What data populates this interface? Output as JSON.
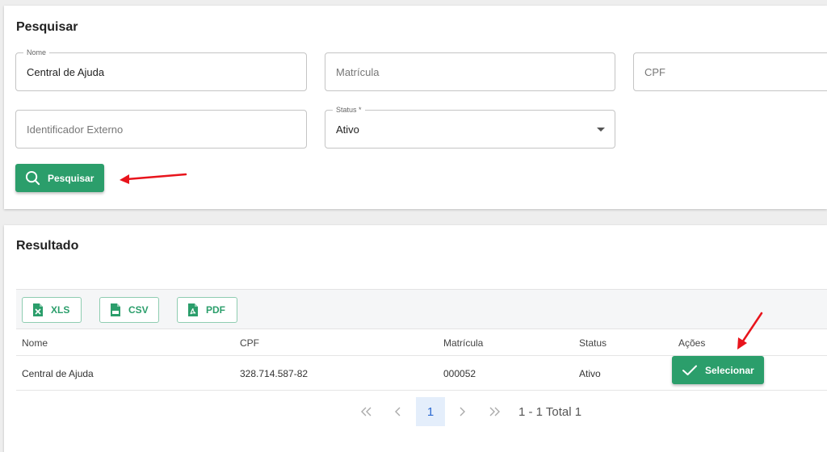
{
  "search": {
    "title": "Pesquisar",
    "fields": {
      "nome": {
        "label": "Nome",
        "value": "Central de Ajuda"
      },
      "matricula": {
        "placeholder": "Matrícula"
      },
      "cpf": {
        "placeholder": "CPF"
      },
      "identificador": {
        "placeholder": "Identificador Externo"
      },
      "status": {
        "label": "Status *",
        "value": "Ativo"
      }
    },
    "button_label": "Pesquisar"
  },
  "result": {
    "title": "Resultado",
    "export": {
      "xls": "XLS",
      "csv": "CSV",
      "pdf": "PDF"
    },
    "columns": [
      "Nome",
      "CPF",
      "Matrícula",
      "Status",
      "Ações"
    ],
    "rows": [
      {
        "nome": "Central de Ajuda",
        "cpf": "328.714.587-82",
        "matricula": "000052",
        "status": "Ativo",
        "action_label": "Selecionar"
      }
    ],
    "pagination": {
      "current_page": "1",
      "info": "1 - 1 Total 1"
    }
  },
  "colors": {
    "accent": "#2b9e6b",
    "annotation": "#e8141c",
    "page_active": "#e4eefb"
  },
  "icons": [
    "search-icon",
    "xls-file-icon",
    "csv-file-icon",
    "pdf-file-icon",
    "check-icon",
    "first-page-icon",
    "prev-page-icon",
    "next-page-icon",
    "last-page-icon",
    "caret-down-icon"
  ]
}
